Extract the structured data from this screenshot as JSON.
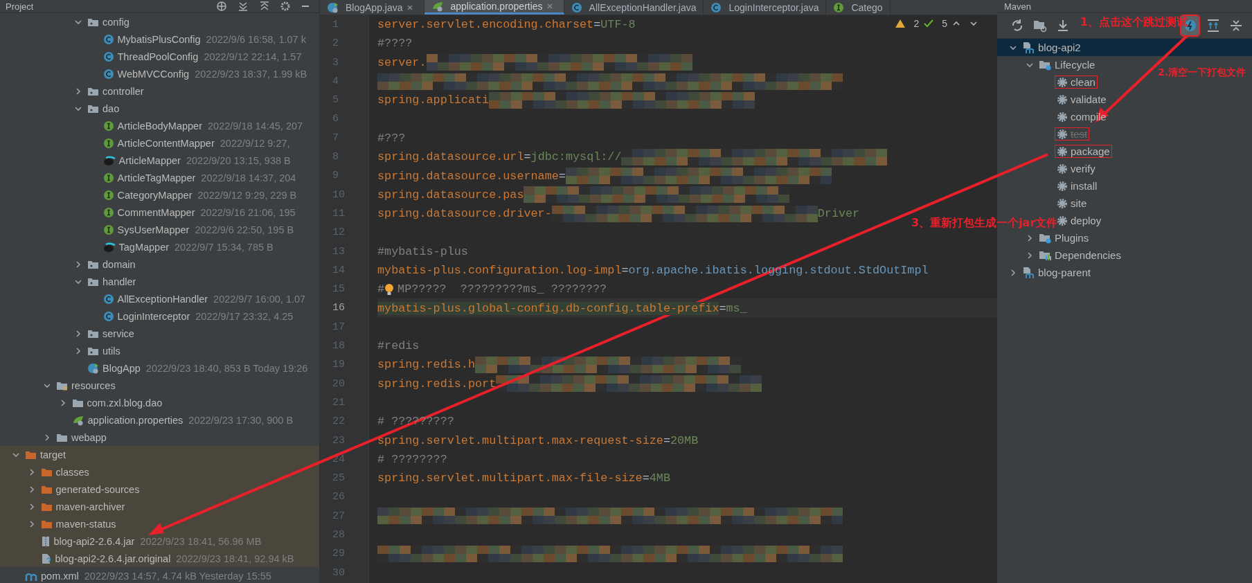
{
  "project_panel": {
    "title": "Project",
    "tree": [
      {
        "children": [
          {
            "children": [
              {
                "children": [
                  {
                    "children": [
                      {
                        "name": "config",
                        "kind": "package",
                        "expanded": true,
                        "children": [
                          {
                            "name": "MybatisPlusConfig",
                            "meta": "2022/9/6 16:58, 1.07 k",
                            "kind": "class"
                          },
                          {
                            "name": "ThreadPoolConfig",
                            "meta": "2022/9/12 22:14, 1.57",
                            "kind": "class"
                          },
                          {
                            "name": "WebMVCConfig",
                            "meta": "2022/9/23 18:37, 1.99 kB",
                            "kind": "class"
                          }
                        ]
                      },
                      {
                        "name": "controller",
                        "kind": "package",
                        "expanded": false
                      },
                      {
                        "name": "dao",
                        "kind": "package",
                        "expanded": true,
                        "children": [
                          {
                            "name": "ArticleBodyMapper",
                            "meta": "2022/9/18 14:45, 207",
                            "kind": "interface"
                          },
                          {
                            "name": "ArticleContentMapper",
                            "meta": "2022/9/12 9:27,",
                            "kind": "interface"
                          },
                          {
                            "name": "ArticleMapper",
                            "meta": "2022/9/20 13:15, 938 B",
                            "kind": "mybatis"
                          },
                          {
                            "name": "ArticleTagMapper",
                            "meta": "2022/9/18 14:37, 204",
                            "kind": "interface"
                          },
                          {
                            "name": "CategoryMapper",
                            "meta": "2022/9/12 9:29, 229 B",
                            "kind": "interface"
                          },
                          {
                            "name": "CommentMapper",
                            "meta": "2022/9/16 21:06, 195",
                            "kind": "interface"
                          },
                          {
                            "name": "SysUserMapper",
                            "meta": "2022/9/6 22:50, 195 B",
                            "kind": "interface"
                          },
                          {
                            "name": "TagMapper",
                            "meta": "2022/9/7 15:34, 785 B",
                            "kind": "mybatis"
                          }
                        ]
                      },
                      {
                        "name": "domain",
                        "kind": "package",
                        "expanded": false
                      },
                      {
                        "name": "handler",
                        "kind": "package",
                        "expanded": true,
                        "children": [
                          {
                            "name": "AllExceptionHandler",
                            "meta": "2022/9/7 16:00, 1.07",
                            "kind": "class"
                          },
                          {
                            "name": "LoginInterceptor",
                            "meta": "2022/9/17 23:32, 4.25",
                            "kind": "class"
                          }
                        ]
                      },
                      {
                        "name": "service",
                        "kind": "package",
                        "expanded": false
                      },
                      {
                        "name": "utils",
                        "kind": "package",
                        "expanded": false
                      },
                      {
                        "name": "BlogApp",
                        "meta": "2022/9/23 18:40, 853 B Today 19:26",
                        "kind": "boot"
                      }
                    ]
                  }
                ]
              },
              {
                "name": "resources",
                "kind": "resources",
                "expanded": true,
                "children": [
                  {
                    "name": "com.zxl.blog.dao",
                    "kind": "folder",
                    "expanded": false
                  },
                  {
                    "name": "application.properties",
                    "meta": "2022/9/23 17:30, 900 B",
                    "kind": "properties"
                  }
                ]
              },
              {
                "name": "webapp",
                "kind": "folder",
                "expanded": false
              }
            ]
          }
        ]
      },
      {
        "name": "target",
        "kind": "excluded",
        "expanded": true,
        "children": [
          {
            "name": "classes",
            "kind": "excluded",
            "expanded": false
          },
          {
            "name": "generated-sources",
            "kind": "excluded",
            "expanded": false
          },
          {
            "name": "maven-archiver",
            "kind": "excluded",
            "expanded": false
          },
          {
            "name": "maven-status",
            "kind": "excluded",
            "expanded": false
          },
          {
            "name": "blog-api2-2.6.4.jar",
            "meta": "2022/9/23 18:41, 56.96 MB",
            "kind": "jar"
          },
          {
            "name": "blog-api2-2.6.4.jar.original",
            "meta": "2022/9/23 18:41, 92.94 kB",
            "kind": "unknown"
          }
        ]
      },
      {
        "name": "pom.xml",
        "meta": "2022/9/23 14:57, 4.74 kB Yesterday 15:55",
        "kind": "maven"
      }
    ]
  },
  "editor": {
    "tabs": [
      {
        "label": "BlogApp.java",
        "kind": "boot",
        "selected": false,
        "closable": true
      },
      {
        "label": "application.properties",
        "kind": "properties",
        "selected": true,
        "closable": true
      },
      {
        "label": "AllExceptionHandler.java",
        "kind": "class",
        "selected": false,
        "closable": false
      },
      {
        "label": "LoginInterceptor.java",
        "kind": "class",
        "selected": false,
        "closable": false
      },
      {
        "label": "Catego",
        "kind": "interface",
        "selected": false,
        "closable": false
      }
    ],
    "inspections": {
      "warnings": "2",
      "passed": "5"
    },
    "lines": [
      {
        "n": "1",
        "key": "server.servlet.encoding.charset",
        "op": "=",
        "value": "UTF-8",
        "current": false
      },
      {
        "n": "2",
        "comment": "#????",
        "current": false
      },
      {
        "n": "3",
        "key": "server.",
        "redacted": true,
        "current": false
      },
      {
        "n": "4",
        "redacted": true,
        "current": false
      },
      {
        "n": "5",
        "key": "spring.applicati",
        "redacted": true,
        "current": false
      },
      {
        "n": "6",
        "current": false
      },
      {
        "n": "7",
        "comment": "#???",
        "current": false
      },
      {
        "n": "8",
        "key": "spring.datasource.url",
        "op": "=",
        "value": "jdbc:mysql://",
        "redacted": true,
        "current": false
      },
      {
        "n": "9",
        "key": "spring.datasource.username",
        "op": "=",
        "redacted": true,
        "current": false
      },
      {
        "n": "10",
        "key": "spring.datasource.pas",
        "redacted": true,
        "current": false
      },
      {
        "n": "11",
        "key": "spring.datasource.driver-",
        "redacted": true,
        "tail": "Driver",
        "current": false
      },
      {
        "n": "12",
        "current": false
      },
      {
        "n": "13",
        "comment": "#mybatis-plus",
        "current": false
      },
      {
        "n": "14",
        "key": "mybatis-plus.configuration.log-impl",
        "op": "=",
        "class_ref": "org.apache.ibatis.logging.stdout.StdOutImpl",
        "current": false
      },
      {
        "n": "15",
        "comment": "#",
        "bulb": true,
        "comment_rest": "MP?????  ?????????ms_ ????????",
        "current": false
      },
      {
        "n": "16",
        "key": "mybatis-plus.global-config.db-config.table-prefix",
        "op": "=",
        "value": "ms_",
        "current": true
      },
      {
        "n": "17",
        "current": false
      },
      {
        "n": "18",
        "comment": "#redis",
        "current": false
      },
      {
        "n": "19",
        "key": "spring.redis.h",
        "redacted": true,
        "current": false
      },
      {
        "n": "20",
        "key": "spring.redis.port",
        "redacted": true,
        "current": false
      },
      {
        "n": "21",
        "current": false
      },
      {
        "n": "22",
        "comment": "# ?????????",
        "current": false
      },
      {
        "n": "23",
        "key": "spring.servlet.multipart.max-request-size",
        "op": "=",
        "value": "20MB",
        "current": false
      },
      {
        "n": "24",
        "comment": "# ????????",
        "current": false
      },
      {
        "n": "25",
        "key": "spring.servlet.multipart.max-file-size",
        "op": "=",
        "value": "4MB",
        "current": false
      },
      {
        "n": "26",
        "current": false
      },
      {
        "n": "27",
        "redacted": true,
        "current": false
      },
      {
        "n": "28",
        "current": false
      },
      {
        "n": "29",
        "redacted": true,
        "current": false
      },
      {
        "n": "30",
        "current": false
      }
    ]
  },
  "maven_panel": {
    "title": "Maven",
    "toolbar": [
      {
        "kind": "refresh",
        "selected": false,
        "annotated": false
      },
      {
        "kind": "folder-refresh",
        "selected": false,
        "annotated": false
      },
      {
        "kind": "download",
        "selected": false,
        "annotated": false
      },
      {
        "kind": "offline",
        "selected": true,
        "annotated": true
      },
      {
        "kind": "expand",
        "selected": false,
        "annotated": false
      },
      {
        "kind": "collapse",
        "selected": false,
        "annotated": false
      }
    ],
    "tree": [
      {
        "name": "blog-api2",
        "kind": "maven-project",
        "expanded": true,
        "selected": true,
        "children": [
          {
            "name": "Lifecycle",
            "kind": "lifecycle",
            "expanded": true,
            "selected": false,
            "children": [
              {
                "name": "clean",
                "kind": "goal",
                "selected": false,
                "skipped": false,
                "annotated": true
              },
              {
                "name": "validate",
                "kind": "goal",
                "selected": false,
                "skipped": false,
                "annotated": false
              },
              {
                "name": "compile",
                "kind": "goal",
                "selected": false,
                "skipped": false,
                "annotated": false
              },
              {
                "name": "test",
                "kind": "goal",
                "selected": false,
                "skipped": true,
                "annotated": true
              },
              {
                "name": "package",
                "kind": "goal",
                "selected": false,
                "skipped": false,
                "annotated": true
              },
              {
                "name": "verify",
                "kind": "goal",
                "selected": false,
                "skipped": false,
                "annotated": false
              },
              {
                "name": "install",
                "kind": "goal",
                "selected": false,
                "skipped": false,
                "annotated": false
              },
              {
                "name": "site",
                "kind": "goal",
                "selected": false,
                "skipped": false,
                "annotated": false
              },
              {
                "name": "deploy",
                "kind": "goal",
                "selected": false,
                "skipped": false,
                "annotated": false
              }
            ]
          },
          {
            "name": "Plugins",
            "kind": "plugins",
            "expanded": false,
            "selected": false
          },
          {
            "name": "Dependencies",
            "kind": "deps",
            "expanded": false,
            "selected": false
          }
        ]
      },
      {
        "name": "blog-parent",
        "kind": "maven-project",
        "expanded": false,
        "selected": false
      }
    ]
  },
  "annotations": [
    {
      "text": "1、点击这个跳过测试"
    },
    {
      "text": "2.清空一下打包文件"
    },
    {
      "text": "3、重新打包生成一个jar文件"
    }
  ]
}
